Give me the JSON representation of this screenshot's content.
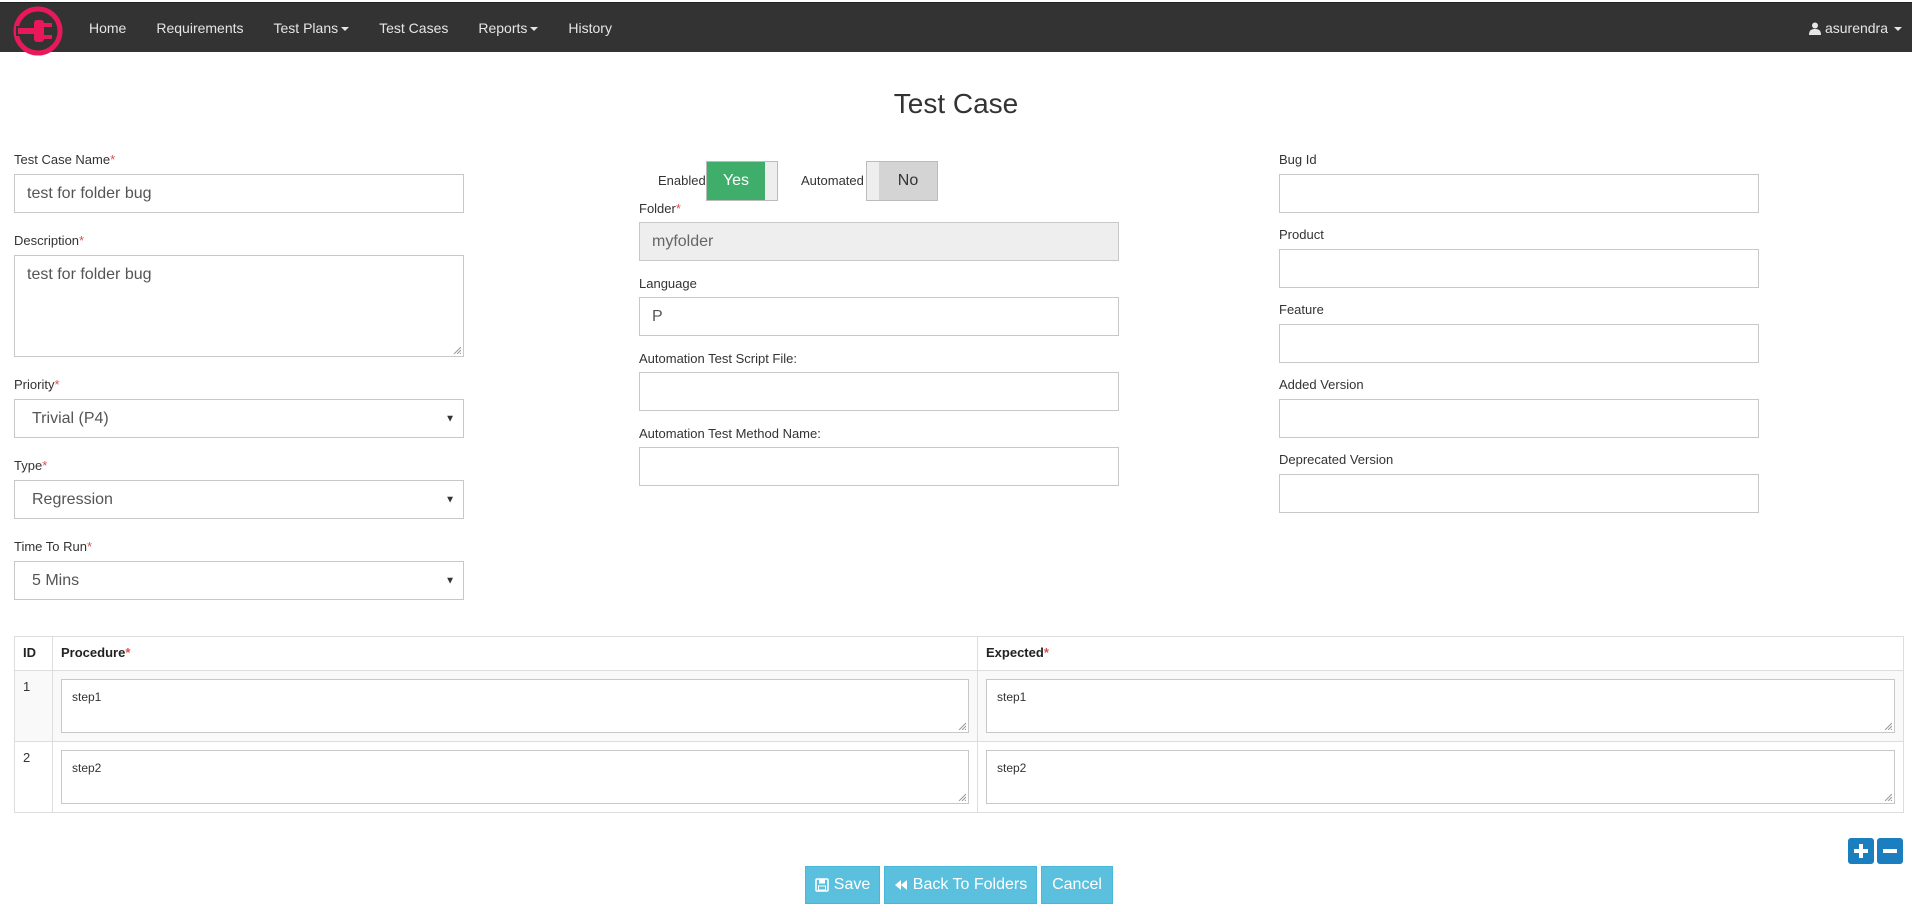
{
  "colors": {
    "navbar": "#333333",
    "brand": "#e8185a",
    "toggle_yes": "#3fae6a",
    "toggle_no": "#d4d4d4",
    "button": "#5bc0de",
    "icon_button": "#1a7ebf",
    "required": "#d9534f"
  },
  "nav": {
    "items": [
      {
        "label": "Home"
      },
      {
        "label": "Requirements"
      },
      {
        "label": "Test Plans",
        "dropdown": true
      },
      {
        "label": "Test Cases"
      },
      {
        "label": "Reports",
        "dropdown": true
      },
      {
        "label": "History"
      }
    ],
    "user": "asurendra",
    "logo_icon": "plug-logo-icon",
    "user_icon": "user-icon"
  },
  "page": {
    "title": "Test Case"
  },
  "left": {
    "name_label": "Test Case Name",
    "name_value": "test for folder bug",
    "description_label": "Description",
    "description_value": "test for folder bug",
    "priority_label": "Priority",
    "priority_value": "Trivial (P4)",
    "type_label": "Type",
    "type_value": "Regression",
    "time_label": "Time To Run",
    "time_value": "5 Mins",
    "required_mark": "*"
  },
  "middle": {
    "enabled_label": "Enabled",
    "enabled_value": "Yes",
    "automated_label": "Automated",
    "automated_value": "No",
    "folder_label": "Folder",
    "folder_value": "myfolder",
    "language_label": "Language",
    "language_value": "P",
    "script_label": "Automation Test Script File:",
    "script_value": "",
    "method_label": "Automation Test Method Name:",
    "method_value": ""
  },
  "right": {
    "bug_label": "Bug Id",
    "product_label": "Product",
    "feature_label": "Feature",
    "added_label": "Added Version",
    "deprecated_label": "Deprecated Version"
  },
  "steps": {
    "headers": {
      "id": "ID",
      "procedure": "Procedure",
      "expected": "Expected"
    },
    "rows": [
      {
        "id": "1",
        "procedure": "step1",
        "expected": "step1"
      },
      {
        "id": "2",
        "procedure": "step2",
        "expected": "step2"
      }
    ],
    "add_icon": "plus-icon",
    "remove_icon": "minus-icon"
  },
  "actions": {
    "save": "Save",
    "back": "Back To Folders",
    "cancel": "Cancel"
  }
}
